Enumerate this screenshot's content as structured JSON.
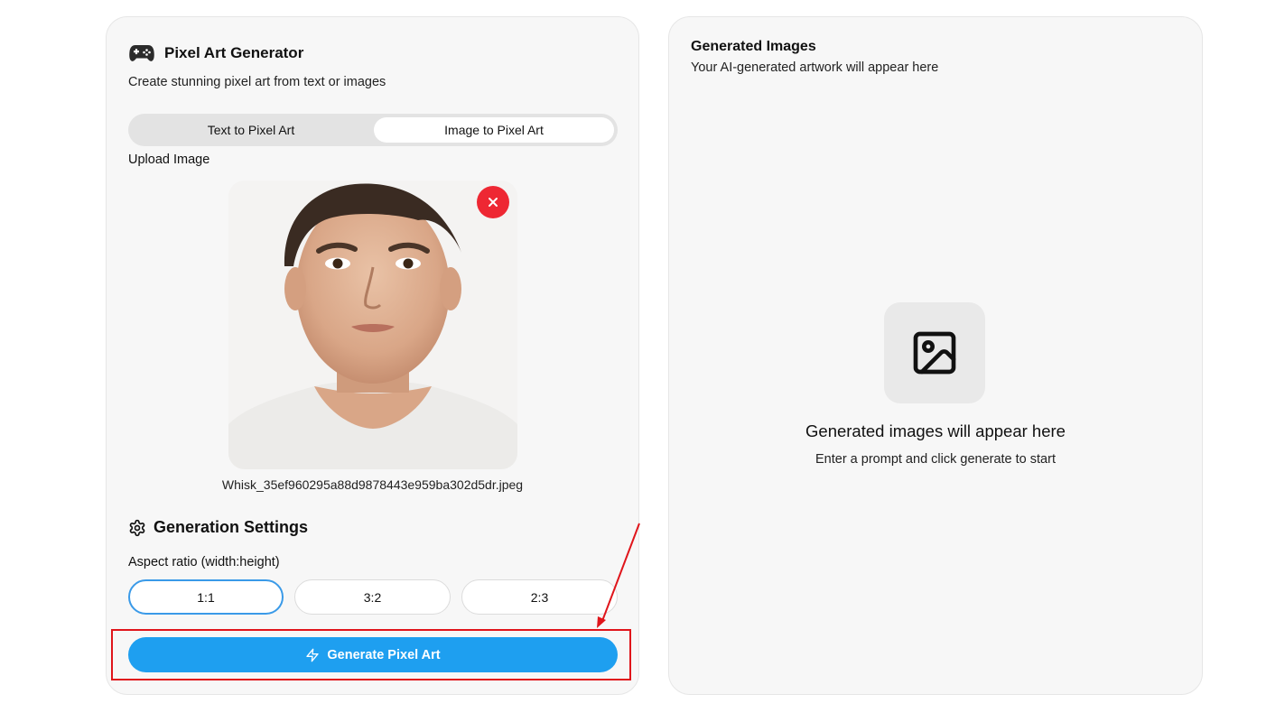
{
  "generator": {
    "title": "Pixel Art Generator",
    "subtitle": "Create stunning pixel art from text or images",
    "title_icon": "gamepad-icon",
    "mode_tabs": [
      {
        "label": "Text to Pixel Art",
        "active": false
      },
      {
        "label": "Image to Pixel Art",
        "active": true
      }
    ],
    "upload_label": "Upload Image",
    "uploaded_file_name": "Whisk_35ef960295a88d9878443e959ba302d5dr.jpeg",
    "remove_icon": "close-icon"
  },
  "settings": {
    "title": "Generation Settings",
    "icon": "gear-icon",
    "aspect_label": "Aspect ratio (width:height)",
    "aspect_options": [
      {
        "label": "1:1",
        "selected": true
      },
      {
        "label": "3:2",
        "selected": false
      },
      {
        "label": "2:3",
        "selected": false
      }
    ],
    "generate_label": "Generate Pixel Art",
    "generate_icon": "lightning-icon"
  },
  "results": {
    "title": "Generated Images",
    "subtitle": "Your AI-generated artwork will appear here",
    "empty_icon": "image-icon",
    "empty_title": "Generated images will appear here",
    "empty_hint": "Enter a prompt and click generate to start"
  },
  "colors": {
    "accent_blue": "#1e9ff0",
    "selected_border": "#3a9ae8",
    "remove_red": "#ee2733",
    "annotation_red": "#e0151b",
    "panel_bg": "#f7f7f7"
  }
}
